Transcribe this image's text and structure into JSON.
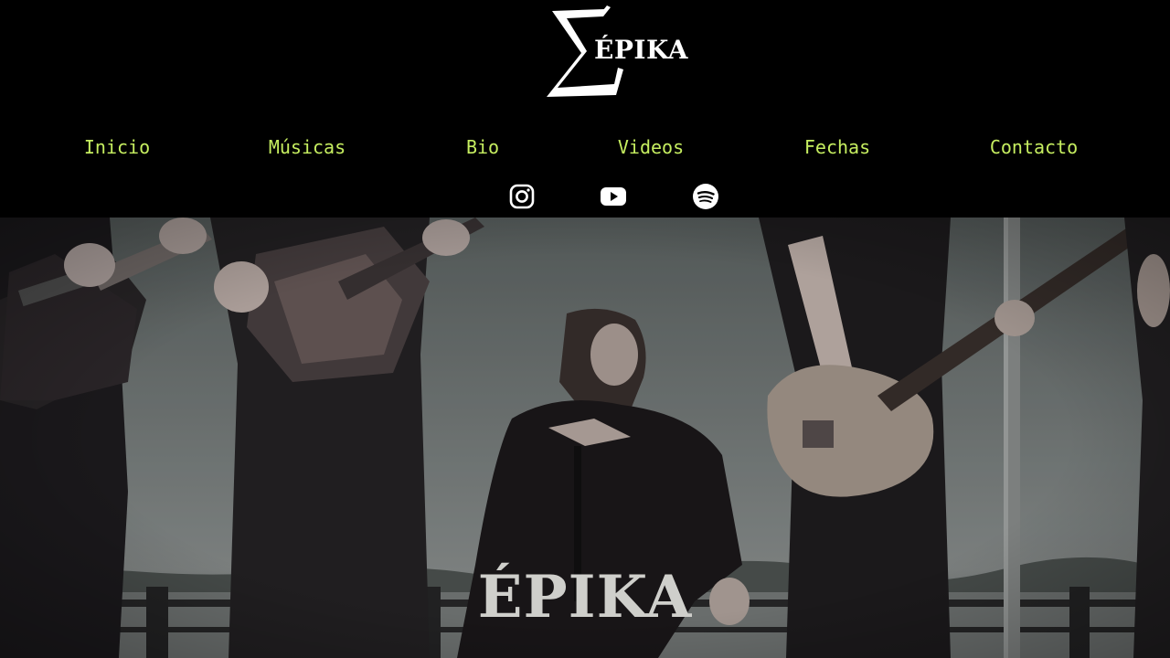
{
  "brand": {
    "logo_text": "ÉPIKA",
    "accent_color": "#c6ee60"
  },
  "nav": {
    "items": [
      {
        "label": "Inicio"
      },
      {
        "label": "Músicas"
      },
      {
        "label": "Bio"
      },
      {
        "label": "Videos"
      },
      {
        "label": "Fechas"
      },
      {
        "label": "Contacto"
      }
    ]
  },
  "social": {
    "links": [
      {
        "icon": "instagram-icon"
      },
      {
        "icon": "youtube-icon"
      },
      {
        "icon": "spotify-icon"
      }
    ]
  },
  "hero": {
    "title": "ÉPIKA",
    "image": "band-photo"
  }
}
